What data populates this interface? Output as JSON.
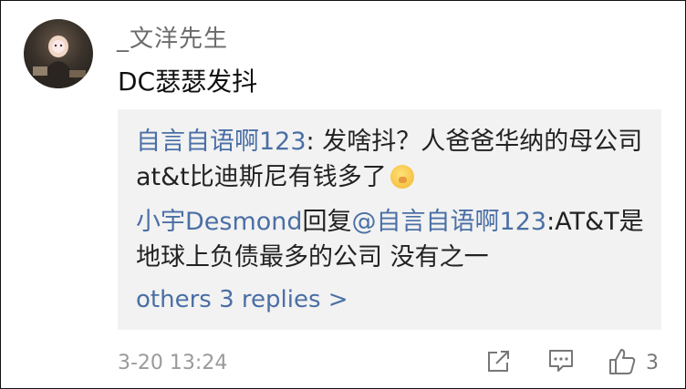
{
  "comment": {
    "username": "_文洋先生",
    "text": "DC瑟瑟发抖",
    "avatar": "avatar-photo",
    "timestamp": "3-20 13:24",
    "like_count": "3"
  },
  "replies": [
    {
      "author": "自言自语啊123",
      "separator": ": ",
      "text": "发啥抖？人爸爸华纳的母公司at&t比迪斯尼有钱多了",
      "emoji": "shush-face-emoji"
    },
    {
      "author": "小宇Desmond",
      "reply_word": "回复",
      "reply_to": "@自言自语啊123",
      "separator": ":",
      "text": "AT&T是地球上负债最多的公司 没有之一"
    }
  ],
  "more_replies_label": "others 3 replies >",
  "colors": {
    "link": "#4a6fa5",
    "reply_bg": "#f2f2f2",
    "meta": "#9a9a9a"
  },
  "icons": [
    "share-icon",
    "comment-icon",
    "thumbs-up-icon"
  ]
}
